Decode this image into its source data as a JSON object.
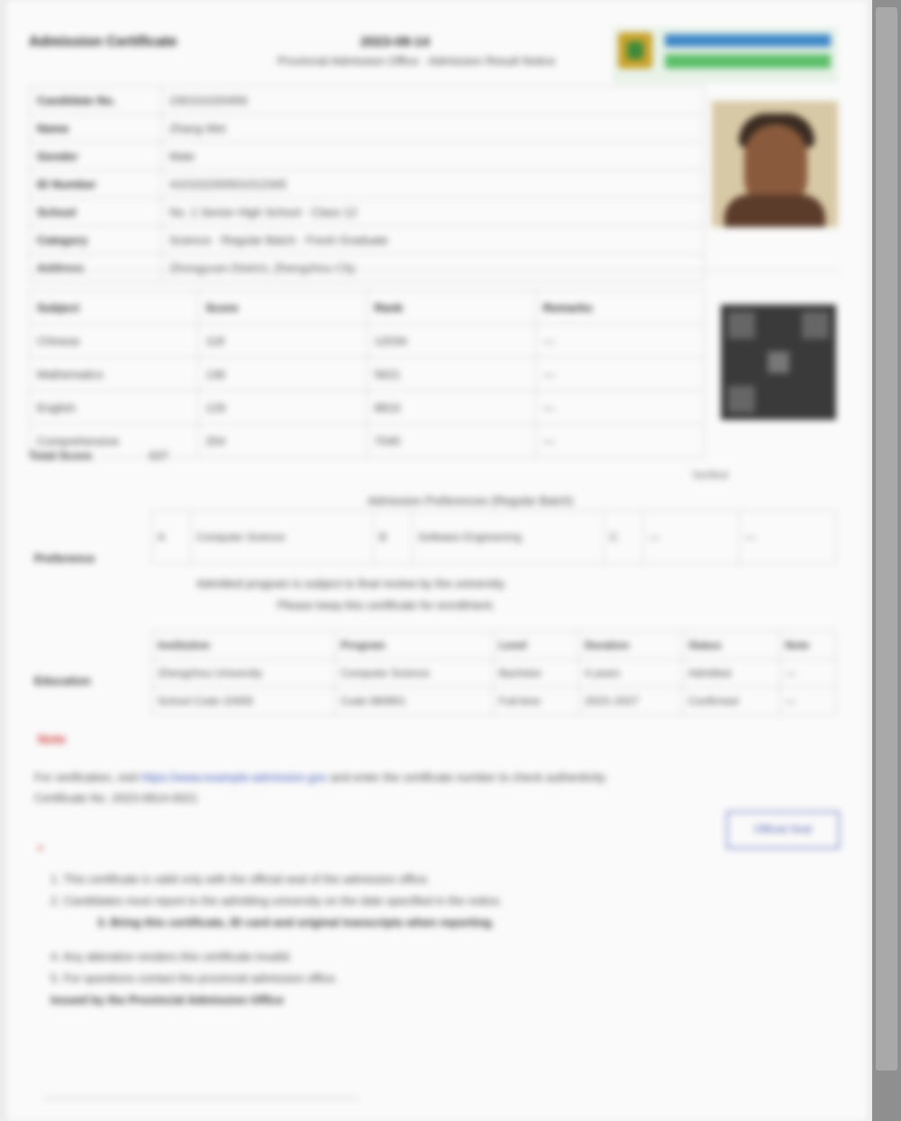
{
  "header": {
    "title": "Admission Certificate",
    "date": "2023-08-14",
    "subtitle": "Provincial Admission Office · Admission Result Notice"
  },
  "candidate": {
    "rows": [
      {
        "label": "Candidate No.",
        "value": "230101020456"
      },
      {
        "label": "Name",
        "value": "Zhang Wei"
      },
      {
        "label": "Gender",
        "value": "Male"
      },
      {
        "label": "ID Number",
        "value": "410102200501012345"
      },
      {
        "label": "School",
        "value": "No. 1 Senior High School · Class 12"
      },
      {
        "label": "Category",
        "value": "Science · Regular Batch · Fresh Graduate"
      },
      {
        "label": "Address",
        "value": "Zhongyuan District, Zhengzhou City"
      }
    ]
  },
  "scores": {
    "header": [
      "Subject",
      "Score",
      "Rank",
      "Remarks"
    ],
    "rows": [
      [
        "Chinese",
        "118",
        "12034",
        "—"
      ],
      [
        "Mathematics",
        "136",
        "5621",
        "—"
      ],
      [
        "English",
        "129",
        "8810",
        "—"
      ],
      [
        "Comprehensive",
        "254",
        "7045",
        "—"
      ]
    ],
    "total_label": "Total Score",
    "total_value": "637",
    "total_note": "Verified"
  },
  "preferences": {
    "heading": "Admission Preferences (Regular Batch)",
    "label": "Preference",
    "cells": [
      "A",
      "Computer Science",
      "B",
      "Software Engineering",
      "C",
      "—",
      "—"
    ],
    "notes": [
      "Admitted program is subject to final review by the university.",
      "Please keep this certificate for enrollment."
    ]
  },
  "education": {
    "label": "Education",
    "header": [
      "Institution",
      "Program",
      "Level",
      "Duration",
      "Status",
      "Note"
    ],
    "rows": [
      [
        "Zhengzhou University",
        "Computer Science",
        "Bachelor",
        "4 years",
        "Admitted",
        "—"
      ],
      [
        "School Code 10459",
        "Code 080901",
        "Full-time",
        "2023–2027",
        "Confirmed",
        "—"
      ]
    ]
  },
  "notices": {
    "mark1": "Note",
    "line1_prefix": "For verification, visit",
    "line1_link": "https://www.example-admission.gov",
    "line1_suffix": "and enter the certificate number to check authenticity.",
    "line2": "Certificate No. 2023-0814-0021",
    "stamp": "Official Seal",
    "mark2": "*",
    "instructions": [
      "1. This certificate is valid only with the official seal of the admission office.",
      "2. Candidates must report to the admitting university on the date specified in the notice.",
      "3. Bring this certificate, ID card and original transcripts when reporting.",
      "4. Any alteration renders this certificate invalid.",
      "5. For questions contact the provincial admission office.",
      "Issued by the Provincial Admission Office"
    ]
  }
}
